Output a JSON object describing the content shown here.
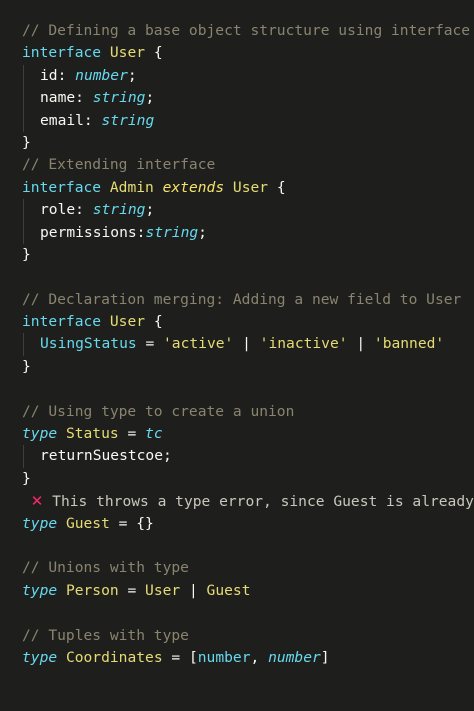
{
  "lines": {
    "l1": "// Defining a base object structure using interface",
    "l2_kw": "interface",
    "l2_name": "User",
    "l2_brace": " {",
    "l3_key": "id: ",
    "l3_type": "number",
    "l3_end": ";",
    "l4_key": "name: ",
    "l4_type": "string",
    "l4_end": ";",
    "l5_key": "email: ",
    "l5_type": "string",
    "l6": "}",
    "l7": "// Extending interface",
    "l8_kw": "interface",
    "l8_name": "Admin",
    "l8_ext": "extends",
    "l8_parent": "User",
    "l8_brace": " {",
    "l9_key": "role: ",
    "l9_type": "string",
    "l9_end": ";",
    "l10_key": "permissions:",
    "l10_type": "string",
    "l10_end": ";",
    "l11": "}",
    "l13": "// Declaration merging: Adding a new field to User",
    "l14_kw": "interface",
    "l14_name": "User",
    "l14_brace": " {",
    "l15_key": "UsingStatus",
    "l15_eq": " = ",
    "l15_s1": "'active'",
    "l15_bar1": " | ",
    "l15_s2": "'inactive'",
    "l15_bar2": " | ",
    "l15_s3": "'banned'",
    "l16": "}",
    "l18": "// Using type to create a union",
    "l19_kw": "type",
    "l19_name": "Status",
    "l19_eq": " = ",
    "l19_val": "tc",
    "l20_text": "returnSuestcoe;",
    "l21": "}",
    "l22_icon": "✕",
    "l22_text": "This throws a type error, since Guest is already",
    "l23_kw": "type",
    "l23_name": "Guest",
    "l23_rest": " = {}",
    "l25": "// Unions with type",
    "l26_kw": "type",
    "l26_name": "Person",
    "l26_eq": " = ",
    "l26_a": "User",
    "l26_bar": " | ",
    "l26_b": "Guest",
    "l28": "// Tuples with type",
    "l29_kw": "type",
    "l29_name": "Coordinates",
    "l29_eq": " = ",
    "l29_open": "[",
    "l29_t1": "number",
    "l29_comma": ", ",
    "l29_t2": "number",
    "l29_close": "]"
  },
  "colors": {
    "background": "#1e1f1c",
    "comment": "#88846f",
    "keyword": "#66d9ef",
    "type_name": "#e6db74",
    "string": "#e6db74",
    "error_icon": "#f92672"
  }
}
